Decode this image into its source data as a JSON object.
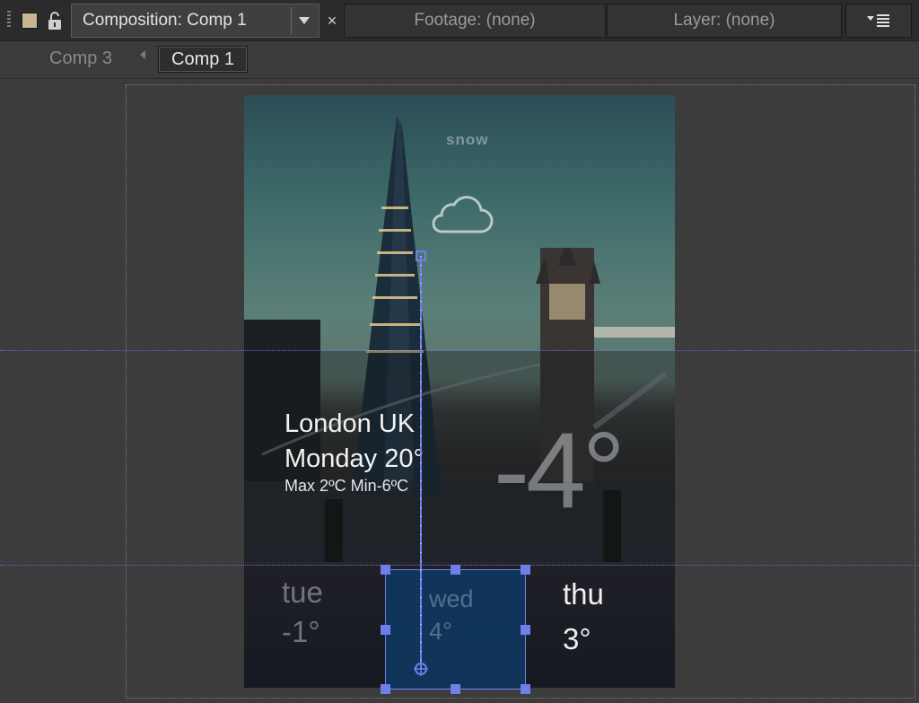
{
  "tabs": {
    "composition": "Composition: Comp 1",
    "footage": "Footage: (none)",
    "layer": "Layer: (none)",
    "close_symbol": "×"
  },
  "breadcrumbs": {
    "items": [
      "Comp 3",
      "Comp 1"
    ]
  },
  "weather": {
    "condition": "snow",
    "condition_icon": "cloud-icon",
    "city": "London UK",
    "day_temp": "Monday 20°",
    "minmax": "Max 2ºC  Min-6ºC",
    "current_temp": "-4°",
    "forecast": [
      {
        "day": "tue",
        "temp": "-1°"
      },
      {
        "day": "wed",
        "temp": "4°"
      },
      {
        "day": "thu",
        "temp": "3°"
      }
    ]
  },
  "colors": {
    "panel_bg": "#2b2b2b",
    "viewer_bg": "#3c3c3c",
    "selection": "#6f7ee8",
    "layer_fill": "#0e3c69",
    "label_swatch": "#c8b690"
  }
}
